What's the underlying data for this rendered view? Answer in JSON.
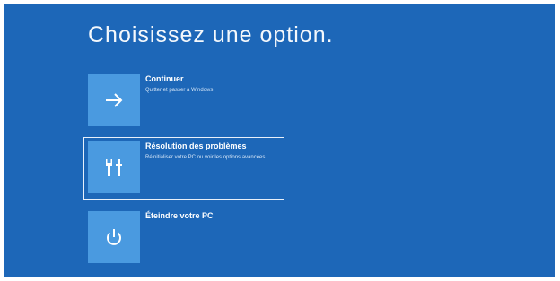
{
  "screen": {
    "background_color": "#1d67b8",
    "tile_color": "#4a9ae0",
    "title": "Choisissez une option."
  },
  "options": [
    {
      "icon": "arrow-right-icon",
      "label": "Continuer",
      "description": "Quitter et passer à Windows",
      "selected": false
    },
    {
      "icon": "tools-icon",
      "label": "Résolution des problèmes",
      "description": "Réinitialiser votre PC ou voir les options avancées",
      "selected": true
    },
    {
      "icon": "power-icon",
      "label": "Éteindre votre PC",
      "description": "",
      "selected": false
    }
  ]
}
